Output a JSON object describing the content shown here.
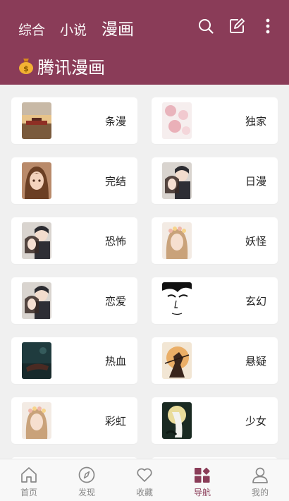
{
  "header": {
    "tabs": [
      {
        "label": "综合"
      },
      {
        "label": "小说"
      },
      {
        "label": "漫画"
      }
    ],
    "active_tab": 2,
    "actions": [
      "search-icon",
      "edit-icon",
      "more-icon"
    ],
    "subtitle": "腾讯漫画",
    "subtitle_icon": "money-bag-icon"
  },
  "categories": [
    {
      "label": "条漫",
      "thumb": "sunset-palace"
    },
    {
      "label": "独家",
      "thumb": "pink-floral"
    },
    {
      "label": "完结",
      "thumb": "girl-brown-hair"
    },
    {
      "label": "日漫",
      "thumb": "couple-suit"
    },
    {
      "label": "恐怖",
      "thumb": "couple-suit"
    },
    {
      "label": "妖怪",
      "thumb": "girl-flower-crown"
    },
    {
      "label": "恋爱",
      "thumb": "couple-suit"
    },
    {
      "label": "玄幻",
      "thumb": "ink-face"
    },
    {
      "label": "热血",
      "thumb": "dark-teal"
    },
    {
      "label": "悬疑",
      "thumb": "warrior-sunset"
    },
    {
      "label": "彩虹",
      "thumb": "girl-flower-crown"
    },
    {
      "label": "少女",
      "thumb": "moon-white-hair"
    }
  ],
  "bottom_nav": [
    {
      "label": "首页",
      "icon": "home-icon"
    },
    {
      "label": "发现",
      "icon": "compass-icon"
    },
    {
      "label": "收藏",
      "icon": "heart-icon"
    },
    {
      "label": "导航",
      "icon": "grid-icon"
    },
    {
      "label": "我的",
      "icon": "user-icon"
    }
  ],
  "active_nav": 3,
  "colors": {
    "brand": "#8a3c58",
    "background": "#f0f0f0",
    "card": "#ffffff"
  }
}
